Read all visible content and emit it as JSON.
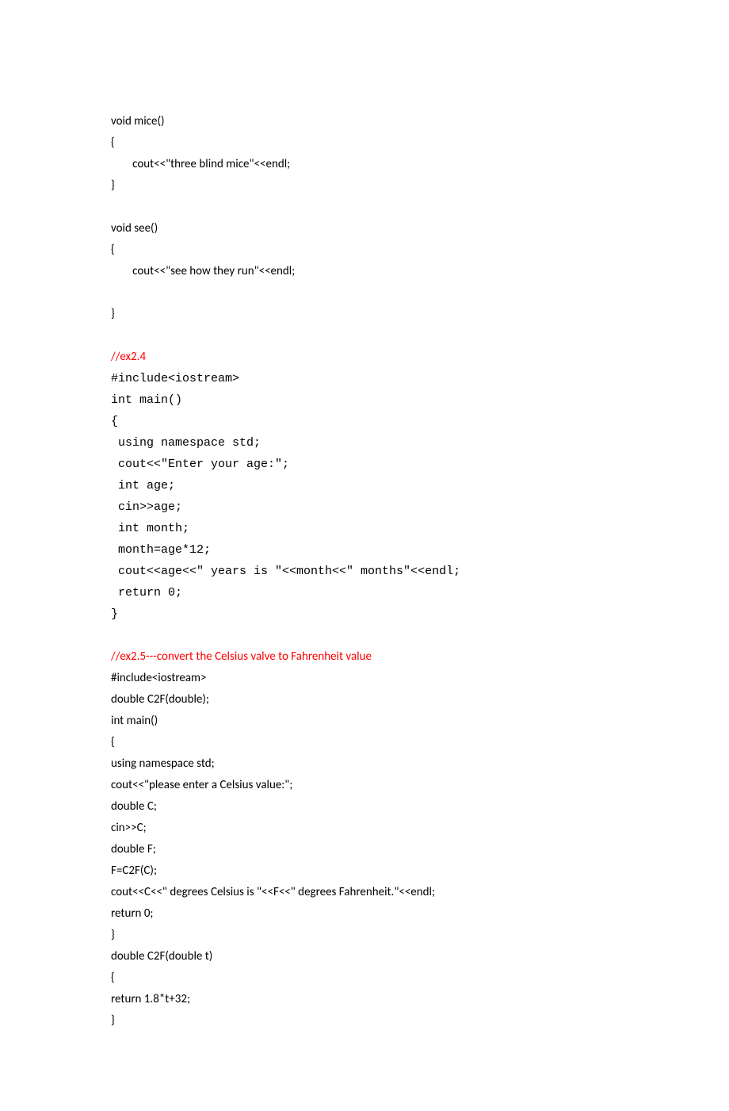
{
  "block1": {
    "l1": "void mice()",
    "l2": "{",
    "l3": "        cout<<\"three blind mice\"<<endl;",
    "l4": "}",
    "l5": "void see()",
    "l6": "{",
    "l7": "        cout<<\"see how they run\"<<endl;",
    "l8": "}"
  },
  "block2": {
    "header": "//ex2.4",
    "l1": "#include<iostream>",
    "l2": "int main()",
    "l3": "{",
    "l4": " using namespace std;",
    "l5": " cout<<\"Enter your age:\";",
    "l6": " int age;",
    "l7": " cin>>age;",
    "l8": " int month;",
    "l9": " month=age*12;",
    "l10": " cout<<age<<\" years is \"<<month<<\" months\"<<endl;",
    "l11": " return 0;",
    "l12": "}"
  },
  "block3": {
    "header": "//ex2.5---convert the Celsius valve to Fahrenheit value",
    "l1": "#include<iostream>",
    "l2": "double C2F(double);",
    "l3": "int main()",
    "l4": "{",
    "l5": "using namespace std;",
    "l6": "cout<<\"please enter a Celsius value:\";",
    "l7": "double C;",
    "l8": "cin>>C;",
    "l9": "double F;",
    "l10": "F=C2F(C);",
    "l11": "cout<<C<<\" degrees Celsius is \"<<F<<\" degrees Fahrenheit.\"<<endl;",
    "l12": "return 0;",
    "l13": "}",
    "l14": "double C2F(double t)",
    "l15": "{",
    "l16": "return 1.8*t+32;",
    "l17": "}"
  }
}
